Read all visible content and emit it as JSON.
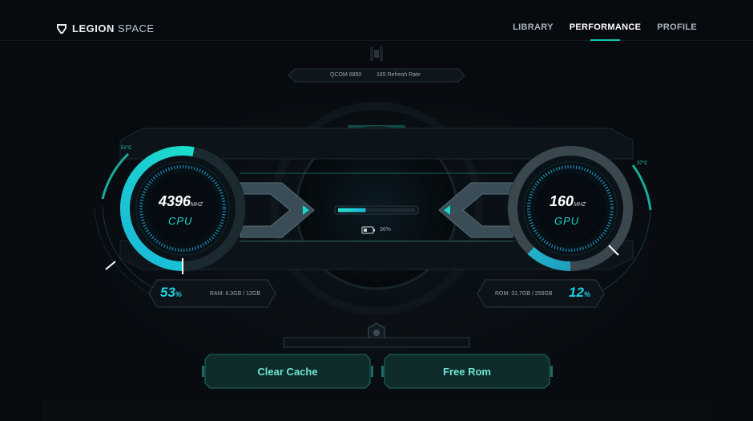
{
  "app": {
    "brand": "LEGION",
    "brand_sub": "SPACE"
  },
  "nav": {
    "items": [
      {
        "label": "LIBRARY",
        "active": false
      },
      {
        "label": "PERFORMANCE",
        "active": true
      },
      {
        "label": "PROFILE",
        "active": false
      }
    ]
  },
  "device_info": {
    "chip": "QCOM 8850",
    "refresh_rate": "165 Refresh Rate"
  },
  "cpu": {
    "frequency": "4396",
    "unit": "MHZ",
    "label": "CPU",
    "temperature": "51°C",
    "usage": "53",
    "usage_unit": "%",
    "usage_fraction": 0.53,
    "ram": "RAM: 6.3GB / 12GB"
  },
  "gpu": {
    "frequency": "160",
    "unit": "MHZ",
    "label": "GPU",
    "temperature": "37°C",
    "usage": "12",
    "usage_unit": "%",
    "usage_fraction": 0.12,
    "rom": "ROM: 31.7GB / 256GB"
  },
  "battery": {
    "percent": "36%",
    "level": 0.36
  },
  "actions": {
    "clear_cache": "Clear Cache",
    "free_rom": "Free Rom"
  },
  "colors": {
    "accent": "#13c9b3",
    "accent_blue": "#21cfe0",
    "background": "#070b10"
  }
}
